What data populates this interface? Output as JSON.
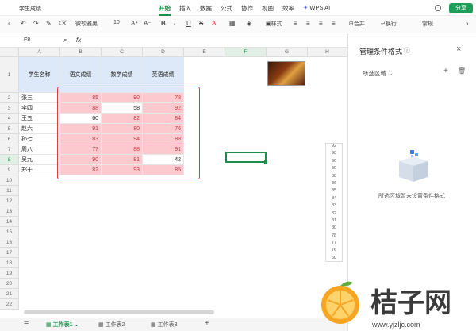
{
  "window": {
    "doc_title": "学生成绩",
    "share_label": "分享"
  },
  "menu": {
    "tabs": [
      "开始",
      "插入",
      "数据",
      "公式",
      "协作",
      "视图",
      "效率"
    ],
    "ai": "WPS AI"
  },
  "toolbar": {
    "font_name": "微软雅黑",
    "font_size": "10",
    "style_label": "样式",
    "merge_label": "合并",
    "wrap_label": "换行",
    "format_label": "常规"
  },
  "formula_bar": {
    "cell_ref": "F8",
    "fx": "fx"
  },
  "columns": [
    "A",
    "B",
    "C",
    "D",
    "E",
    "F",
    "G",
    "H"
  ],
  "rows": [
    "1",
    "2",
    "3",
    "4",
    "5",
    "6",
    "7",
    "8",
    "9",
    "10",
    "11",
    "12",
    "13",
    "14",
    "15",
    "16",
    "17",
    "18",
    "19",
    "20",
    "21",
    "22"
  ],
  "table": {
    "headers": [
      "学生名称",
      "语文成绩",
      "数学成绩",
      "英语成绩"
    ],
    "data": [
      {
        "name": "张三",
        "chinese": "85",
        "math": "90",
        "english": "78"
      },
      {
        "name": "李四",
        "chinese": "88",
        "math": "58",
        "english": "92"
      },
      {
        "name": "王五",
        "chinese": "60",
        "math": "82",
        "english": "84"
      },
      {
        "name": "赵六",
        "chinese": "91",
        "math": "80",
        "english": "76"
      },
      {
        "name": "孙七",
        "chinese": "83",
        "math": "94",
        "english": "88"
      },
      {
        "name": "周八",
        "chinese": "77",
        "math": "88",
        "english": "91"
      },
      {
        "name": "吴九",
        "chinese": "90",
        "math": "81",
        "english": "42"
      },
      {
        "name": "郑十",
        "chinese": "82",
        "math": "93",
        "english": "85"
      }
    ]
  },
  "floating_list": [
    "92",
    "90",
    "90",
    "90",
    "88",
    "86",
    "85",
    "84",
    "83",
    "82",
    "81",
    "80",
    "78",
    "77",
    "76",
    "60"
  ],
  "panel": {
    "title": "管理条件格式",
    "scope_label": "所选区域",
    "empty_text": "所选区域暂未设置条件格式"
  },
  "sheets": {
    "tabs": [
      "工作表1",
      "工作表2",
      "工作表3"
    ],
    "add": "+"
  },
  "watermark": {
    "text": "桔子网",
    "url": "www.yjzljc.com"
  },
  "colors": {
    "accent": "#1a8f4a",
    "highlight": "#fbc9ce",
    "highlight_text": "#c23a45",
    "header_fill": "#dde9f8",
    "box": "#e03a3a"
  }
}
